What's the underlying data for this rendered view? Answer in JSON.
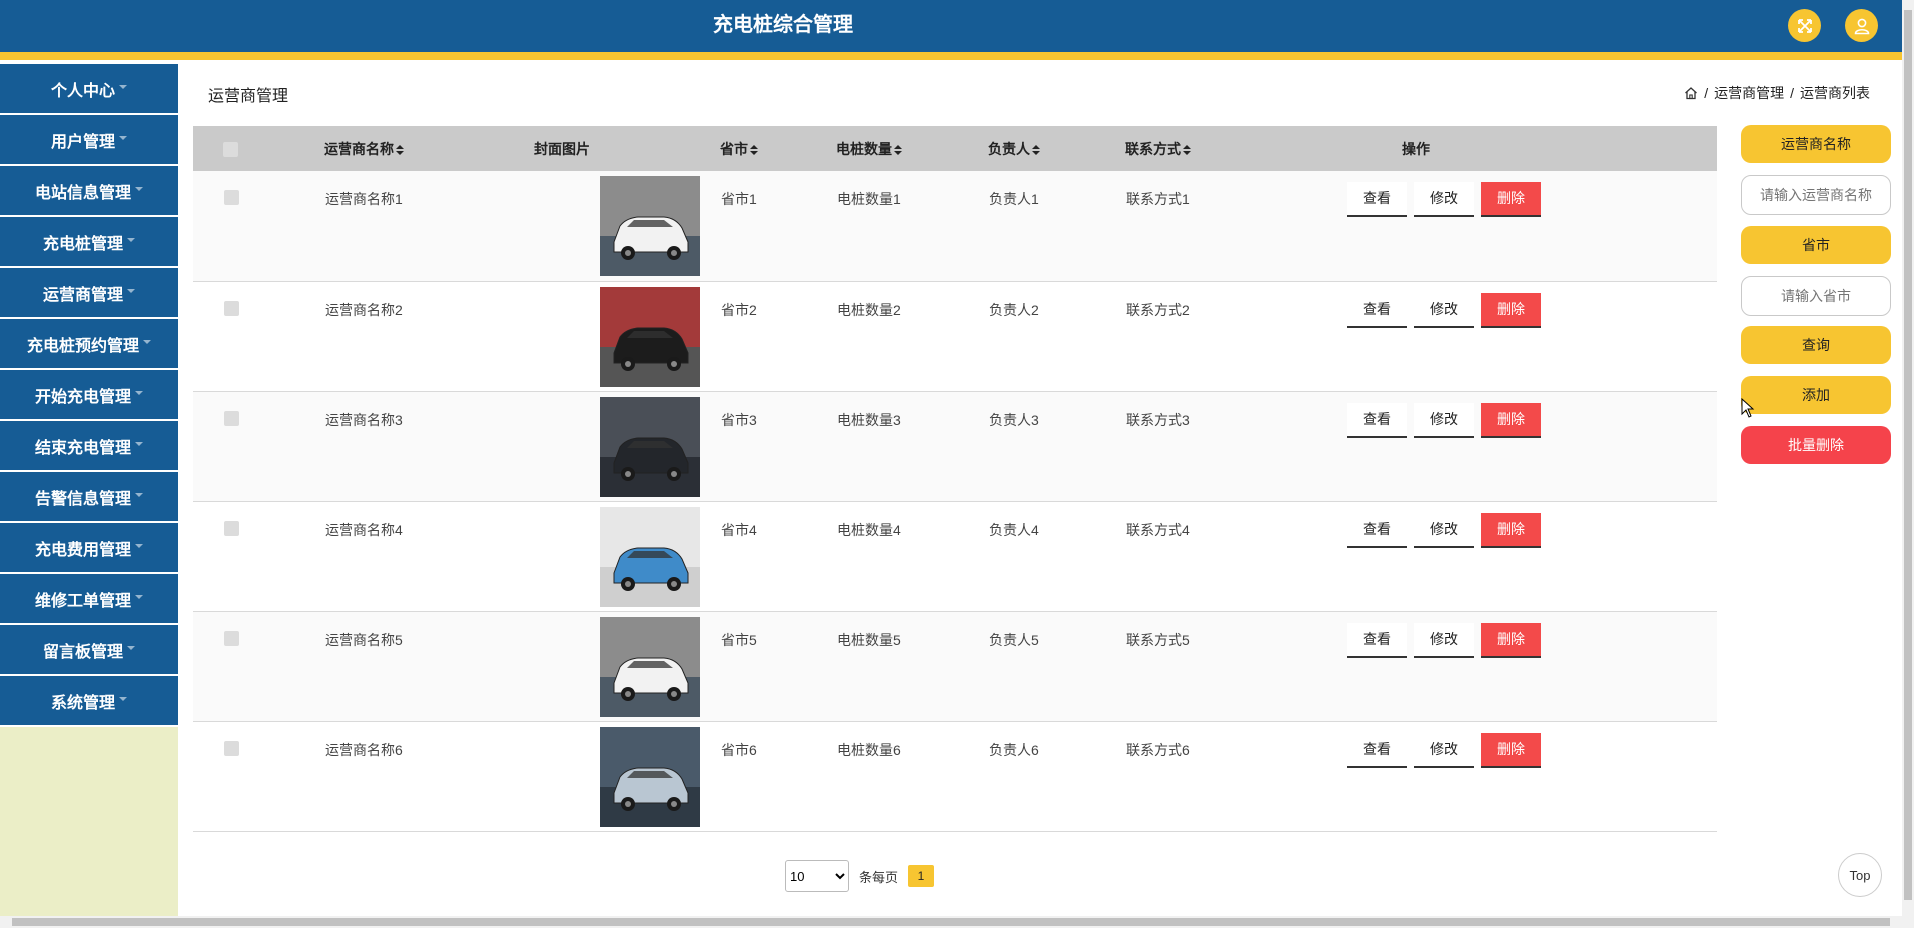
{
  "header": {
    "title": "充电桩综合管理",
    "fullscreen_icon": "fullscreen-icon",
    "user_icon": "user-icon"
  },
  "sidebar": {
    "items": [
      {
        "label": "个人中心"
      },
      {
        "label": "用户管理"
      },
      {
        "label": "电站信息管理"
      },
      {
        "label": "充电桩管理"
      },
      {
        "label": "运营商管理"
      },
      {
        "label": "充电桩预约管理"
      },
      {
        "label": "开始充电管理"
      },
      {
        "label": "结束充电管理"
      },
      {
        "label": "告警信息管理"
      },
      {
        "label": "充电费用管理"
      },
      {
        "label": "维修工单管理"
      },
      {
        "label": "留言板管理"
      },
      {
        "label": "系统管理"
      }
    ]
  },
  "page": {
    "title": "运营商管理"
  },
  "breadcrumb": {
    "home_icon": "home-icon",
    "sep": "/",
    "level1": "运营商管理",
    "level2": "运营商列表"
  },
  "table": {
    "columns": {
      "name": "运营商名称",
      "image": "封面图片",
      "province": "省市",
      "piles": "电桩数量",
      "owner": "负责人",
      "contact": "联系方式",
      "ops": "操作"
    },
    "rows": [
      {
        "name": "运营商名称1",
        "province": "省市1",
        "piles": "电桩数量1",
        "owner": "负责人1",
        "contact": "联系方式1",
        "image": "white-suv"
      },
      {
        "name": "运营商名称2",
        "province": "省市2",
        "piles": "电桩数量2",
        "owner": "负责人2",
        "contact": "联系方式2",
        "image": "black-car-showroom"
      },
      {
        "name": "运营商名称3",
        "province": "省市3",
        "piles": "电桩数量3",
        "owner": "负责人3",
        "contact": "联系方式3",
        "image": "dark-car-front"
      },
      {
        "name": "运营商名称4",
        "province": "省市4",
        "piles": "电桩数量4",
        "owner": "负责人4",
        "contact": "联系方式4",
        "image": "blue-hatchback"
      },
      {
        "name": "运营商名称5",
        "province": "省市5",
        "piles": "电桩数量5",
        "owner": "负责人5",
        "contact": "联系方式5",
        "image": "white-suv"
      },
      {
        "name": "运营商名称6",
        "province": "省市6",
        "piles": "电桩数量6",
        "owner": "负责人6",
        "contact": "联系方式6",
        "image": "silver-sedan"
      }
    ],
    "actions": {
      "view": "查看",
      "edit": "修改",
      "delete": "删除"
    }
  },
  "search_panel": {
    "name_label": "运营商名称",
    "name_placeholder": "请输入运营商名称",
    "province_label": "省市",
    "province_placeholder": "请输入省市",
    "query_button": "查询",
    "add_button": "添加",
    "batch_delete_button": "批量删除"
  },
  "pagination": {
    "page_size": "10",
    "page_size_options": [
      "10"
    ],
    "per_page_label": "条每页",
    "current_page": "1"
  },
  "top_button": "Top",
  "colors": {
    "header_blue": "#165c95",
    "accent_yellow": "#f7c531",
    "danger_red": "#f34a4a",
    "sidebar_bg": "#ebeec7"
  }
}
